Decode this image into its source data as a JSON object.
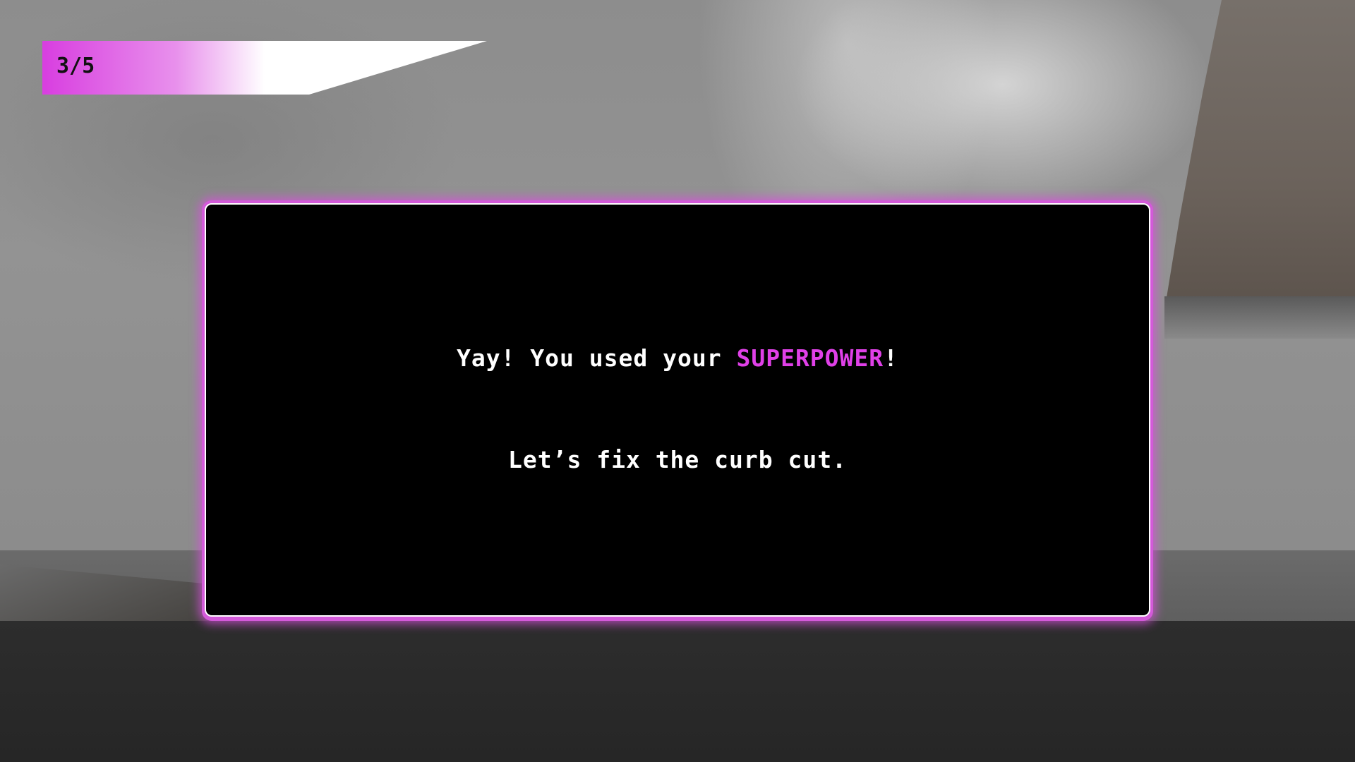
{
  "hud": {
    "progress_label": "3/5",
    "progress": {
      "current": 3,
      "total": 5
    }
  },
  "dialog": {
    "line1_prefix": "Yay! You used your ",
    "line1_highlight": "SUPERPOWER",
    "line1_suffix": "!",
    "line2": "Let’s fix the curb cut."
  },
  "colors": {
    "accent": "#e040e8",
    "dialog_background": "#000000",
    "dialog_text": "#ffffff",
    "dialog_border_glow": "#d35ad9"
  }
}
